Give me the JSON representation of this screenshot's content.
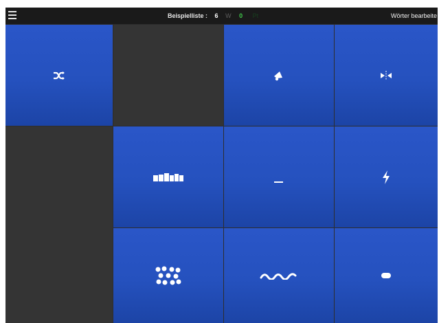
{
  "topbar": {
    "menu_icon": "hamburger-menu-icon",
    "list_label": "Beispielliste :",
    "count": "6",
    "w_label": "W",
    "score": "0",
    "pt_label": "Pt",
    "edit_label": "Wörter bearbeite",
    "colors": {
      "count": "#ffffff",
      "w": "#5d5d5d",
      "score": "#3fc94a",
      "pt": "#173f1f"
    }
  },
  "grid": {
    "tile_color": "#2650c2",
    "empty_color": "#343434",
    "tiles": [
      {
        "row": 1,
        "col": 1,
        "icon": "shuffle-icon",
        "active": true
      },
      {
        "row": 1,
        "col": 2,
        "icon": "",
        "active": false
      },
      {
        "row": 1,
        "col": 3,
        "icon": "megaphone-icon",
        "active": true
      },
      {
        "row": 1,
        "col": 4,
        "icon": "mirror-arrows-icon",
        "active": true
      },
      {
        "row": 2,
        "col": 1,
        "icon": "",
        "active": false
      },
      {
        "row": 2,
        "col": 2,
        "icon": "blocks-row-icon",
        "active": true
      },
      {
        "row": 2,
        "col": 3,
        "icon": "underscore-icon",
        "active": true
      },
      {
        "row": 2,
        "col": 4,
        "icon": "lightning-icon",
        "active": true
      },
      {
        "row": 3,
        "col": 1,
        "icon": "",
        "active": false
      },
      {
        "row": 3,
        "col": 2,
        "icon": "dots-cluster-icon",
        "active": true
      },
      {
        "row": 3,
        "col": 3,
        "icon": "wave-icon",
        "active": true
      },
      {
        "row": 3,
        "col": 4,
        "icon": "pill-icon",
        "active": true
      }
    ]
  }
}
